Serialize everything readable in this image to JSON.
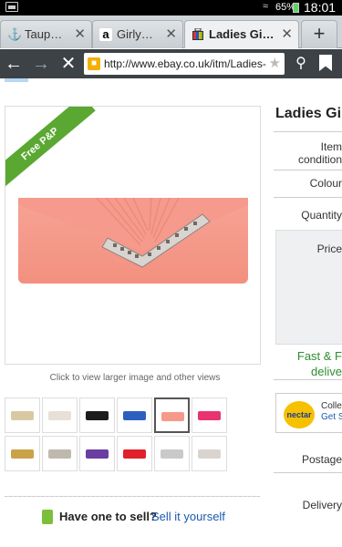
{
  "status_bar": {
    "battery_percent": "65%",
    "time": "18:01"
  },
  "tabs": [
    {
      "label": "Taup…",
      "icon": "ship-favicon-icon"
    },
    {
      "label": "Girly…",
      "icon": "amazon-favicon-icon"
    },
    {
      "label": "Ladies Gi…",
      "icon": "ebay-favicon-icon",
      "active": true
    }
  ],
  "new_tab_label": "+",
  "url_bar": {
    "url": "http://www.ebay.co.uk/itm/Ladies-"
  },
  "listing": {
    "badge": "Free P&P",
    "title": "Ladies Gir",
    "image_caption": "Click to view larger image and other views",
    "fields": {
      "item_condition_1": "Item",
      "item_condition_2": "condition",
      "colour": "Colour",
      "quantity": "Quantity",
      "price": "Price",
      "postage": "Postage",
      "delivery": "Delivery"
    },
    "fast_line_1": "Fast & F",
    "fast_line_2": "delive",
    "nectar_logo_text": "nectar",
    "nectar_line_1": "Collec",
    "nectar_line_2": "Get St"
  },
  "thumbnails": [
    {
      "color": "#d9c9a3"
    },
    {
      "color": "#e6e0d6"
    },
    {
      "color": "#1c1c1c"
    },
    {
      "color": "#2d5fbf"
    },
    {
      "color": "#f59a8a",
      "selected": true
    },
    {
      "color": "#e8336e"
    },
    {
      "color": "#c9a24a"
    },
    {
      "color": "#bfb8ad"
    },
    {
      "color": "#6a3ea0"
    },
    {
      "color": "#e0202a"
    },
    {
      "color": "#c9c9c9"
    },
    {
      "color": "#d9d4cf"
    }
  ],
  "sell": {
    "question": "Have one to sell?",
    "link": "Sell it yourself"
  },
  "colors": {
    "free_pp_green": "#5aa832",
    "link_blue": "#1a5bb0",
    "fast_green": "#2f8d2f"
  }
}
